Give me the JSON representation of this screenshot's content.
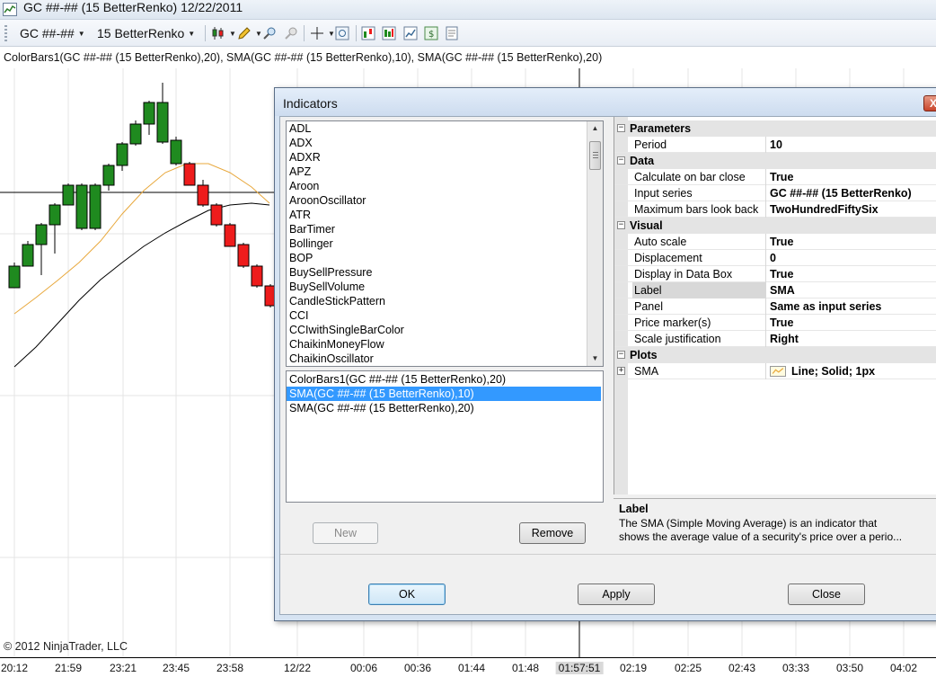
{
  "window": {
    "title": "GC ##-## (15 BetterRenko)  12/22/2011"
  },
  "toolbar": {
    "instrument": "GC ##-##",
    "bartype": "15 BetterRenko"
  },
  "legend": "ColorBars1(GC ##-## (15 BetterRenko),20),  SMA(GC ##-## (15 BetterRenko),10),  SMA(GC ##-## (15 BetterRenko),20)",
  "copyright": "© 2012 NinjaTrader, LLC",
  "xaxis": {
    "labels": [
      "20:12",
      "21:59",
      "23:21",
      "23:45",
      "23:58",
      "12/22",
      "00:06",
      "00:36",
      "01:44",
      "01:48",
      "01:57:51",
      "02:19",
      "02:25",
      "02:43",
      "03:33",
      "03:50",
      "04:02"
    ]
  },
  "colors": {
    "up": "#1f8a1f",
    "down": "#ee1c1c",
    "sma10": "#e8a83c",
    "sma20": "#000000",
    "selection": "#3399ff"
  },
  "dialog": {
    "title": "Indicators",
    "close_glyph": "X",
    "available": [
      "ADL",
      "ADX",
      "ADXR",
      "APZ",
      "Aroon",
      "AroonOscillator",
      "ATR",
      "BarTimer",
      "Bollinger",
      "BOP",
      "BuySellPressure",
      "BuySellVolume",
      "CandleStickPattern",
      "CCI",
      "CCIwithSingleBarColor",
      "ChaikinMoneyFlow",
      "ChaikinOscillator"
    ],
    "applied": [
      "ColorBars1(GC ##-## (15 BetterRenko),20)",
      "SMA(GC ##-## (15 BetterRenko),10)",
      "SMA(GC ##-## (15 BetterRenko),20)"
    ],
    "applied_selected_index": 1,
    "buttons": {
      "new": "New",
      "remove": "Remove",
      "ok": "OK",
      "apply": "Apply",
      "close": "Close"
    },
    "properties": {
      "parameters": {
        "label": "Parameters",
        "period_name": "Period",
        "period_value": "10"
      },
      "data": {
        "label": "Data",
        "calc_name": "Calculate on bar close",
        "calc_value": "True",
        "input_name": "Input series",
        "input_value": "GC ##-## (15 BetterRenko)",
        "maxbars_name": "Maximum bars look back",
        "maxbars_value": "TwoHundredFiftySix"
      },
      "visual": {
        "label": "Visual",
        "autoscale_name": "Auto scale",
        "autoscale_value": "True",
        "displacement_name": "Displacement",
        "displacement_value": "0",
        "databox_name": "Display in Data Box",
        "databox_value": "True",
        "label_name": "Label",
        "label_value": "SMA",
        "panel_name": "Panel",
        "panel_value": "Same as input series",
        "pricemarker_name": "Price marker(s)",
        "pricemarker_value": "True",
        "scalejust_name": "Scale justification",
        "scalejust_value": "Right"
      },
      "plots": {
        "label": "Plots",
        "sma_name": "SMA",
        "sma_value": "Line; Solid; 1px"
      }
    },
    "help": {
      "title": "Label",
      "text_line1": "The SMA (Simple Moving Average) is an indicator that",
      "text_line2": "shows the average value of a security's price over a perio..."
    }
  }
}
